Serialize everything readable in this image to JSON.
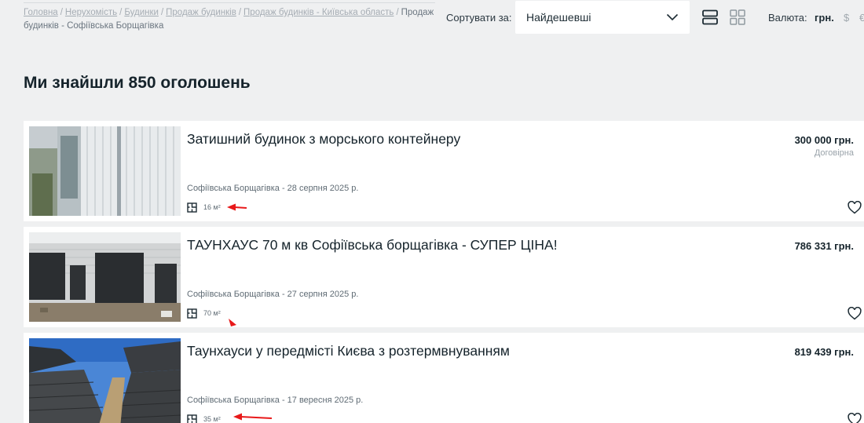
{
  "breadcrumb": {
    "items": [
      "Головна",
      "Нерухомість",
      "Будинки",
      "Продаж будинків",
      "Продаж будинків - Київська область"
    ],
    "current": "Продаж будинків - Софіївська Борщагівка"
  },
  "sort": {
    "label": "Сортувати за:",
    "value": "Найдешевші"
  },
  "currency": {
    "label": "Валюта:",
    "uah": "грн.",
    "usd": "$",
    "eur": "€"
  },
  "results": {
    "title": "Ми знайшли 850 оголошень"
  },
  "listings": [
    {
      "title": "Затишний будинок з морського контейнеру",
      "price": "300 000 грн.",
      "price_note": "Договірна",
      "meta": "Софіївська Борщагівка - 28 серпня 2025 р.",
      "area": "16 м²"
    },
    {
      "title": "ТАУНХАУС 70 м кв Софіївська борщагівка - СУПЕР ЦІНА!",
      "price": "786 331 грн.",
      "price_note": "",
      "meta": "Софіївська Борщагівка - 27 серпня 2025 р.",
      "area": "70 м²"
    },
    {
      "title": "Таунхауси у передмісті Києва з розтермвнуванням",
      "price": "819 439 грн.",
      "price_note": "",
      "meta": "Софіївська Борщагівка - 17 вересня 2025 р.",
      "area": "35 м²"
    }
  ],
  "icons": {
    "sort_chevron": "chevron-down-icon",
    "view_list": "list-view-icon",
    "view_grid": "grid-view-icon",
    "area": "floor-plan-icon",
    "favorite": "heart-icon",
    "annotation": "red-arrow"
  },
  "colors": {
    "background": "#eff0f1",
    "card": "#ffffff",
    "text": "#15232b",
    "annotation": "#e8191a"
  }
}
